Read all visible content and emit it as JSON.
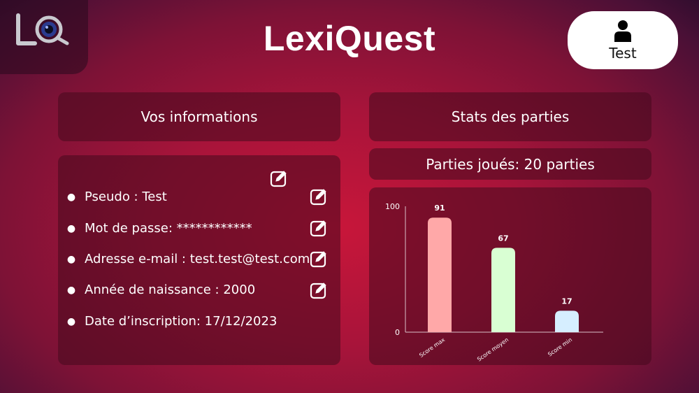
{
  "app": {
    "title": "LexiQuest"
  },
  "user": {
    "name": "Test",
    "icon": "user-icon"
  },
  "info": {
    "title": "Vos informations",
    "items": [
      {
        "label": "Pseudo : Test",
        "editable": true
      },
      {
        "label": "Mot de passe: ************",
        "editable": true
      },
      {
        "label": "Adresse e-mail : test.test@test.com",
        "editable": true
      },
      {
        "label": "Année de naissance : 2000",
        "editable": true
      },
      {
        "label": "Date d’inscription: 17/12/2023",
        "editable": false
      }
    ]
  },
  "stats": {
    "title": "Stats des parties",
    "games_played": "Parties joués: 20 parties"
  },
  "chart_data": {
    "type": "bar",
    "categories": [
      "Score max",
      "Score moyen",
      "Score min"
    ],
    "values": [
      91,
      67,
      17
    ],
    "colors": [
      "#ffa8a8",
      "#d9ffd3",
      "#d6eeff"
    ],
    "ylim": [
      0,
      100
    ],
    "yticks": [
      "0",
      "100"
    ],
    "data_labels": [
      "91",
      "67",
      "17"
    ]
  }
}
